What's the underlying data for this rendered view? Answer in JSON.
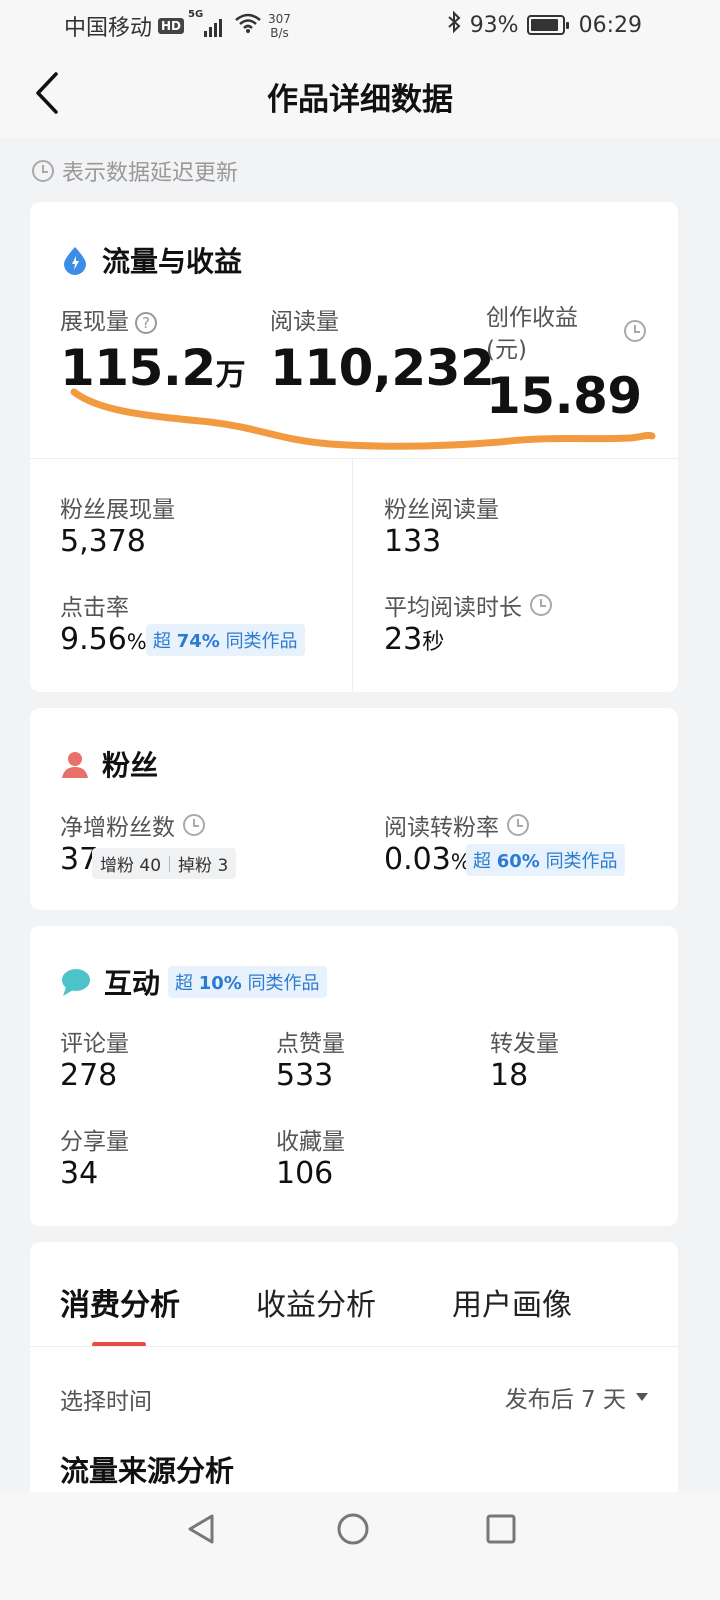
{
  "status_bar": {
    "carrier": "中国移动",
    "hd": "HD",
    "network": "5G",
    "net_speed_value": "307",
    "net_speed_unit": "B/s",
    "battery": "93%",
    "battery_level": 0.93,
    "time": "06:29"
  },
  "nav": {
    "title": "作品详细数据"
  },
  "notice": "表示数据延迟更新",
  "traffic": {
    "heading": "流量与收益",
    "impressions_label": "展现量",
    "impressions_value": "115.2",
    "impressions_unit": "万",
    "reads_label": "阅读量",
    "reads_value": "110,232",
    "income_label": "创作收益",
    "income_unit_label": "(元)",
    "income_value": "15.89",
    "fan_impressions_label": "粉丝展现量",
    "fan_impressions_value": "5,378",
    "fan_reads_label": "粉丝阅读量",
    "fan_reads_value": "133",
    "ctr_label": "点击率",
    "ctr_value": "9.56",
    "ctr_unit": "%",
    "ctr_tag_prefix": "超",
    "ctr_tag_pct": "74%",
    "ctr_tag_suffix": "同类作品",
    "avg_read_label": "平均阅读时长",
    "avg_read_value": "23",
    "avg_read_unit": "秒"
  },
  "fans": {
    "heading": "粉丝",
    "net_gain_label": "净增粉丝数",
    "net_gain_value": "37",
    "gain_label": "增粉",
    "gain_value": "40",
    "lost_label": "掉粉",
    "lost_value": "3",
    "conv_label": "阅读转粉率",
    "conv_value": "0.03",
    "conv_unit": "%",
    "conv_tag_prefix": "超",
    "conv_tag_pct": "60%",
    "conv_tag_suffix": "同类作品"
  },
  "interaction": {
    "heading": "互动",
    "tag_prefix": "超",
    "tag_pct": "10%",
    "tag_suffix": "同类作品",
    "comments_label": "评论量",
    "comments_value": "278",
    "likes_label": "点赞量",
    "likes_value": "533",
    "reposts_label": "转发量",
    "reposts_value": "18",
    "shares_label": "分享量",
    "shares_value": "34",
    "favorites_label": "收藏量",
    "favorites_value": "106"
  },
  "analysis": {
    "tabs": [
      "消费分析",
      "收益分析",
      "用户画像"
    ],
    "active_tab": 0,
    "time_label": "选择时间",
    "time_value": "发布后 7 天",
    "section_title": "流量来源分析"
  },
  "colors": {
    "accent_red": "#e84c3d",
    "tag_blue": "#2c7bd0",
    "annotation_orange": "#f29a3f",
    "fans_icon": "#e8706a",
    "traffic_icon": "#3c8de8",
    "chat_icon": "#4cc3c9"
  }
}
